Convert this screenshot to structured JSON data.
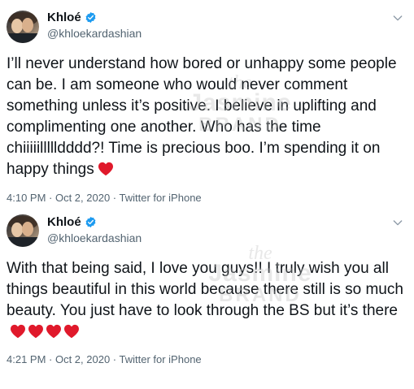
{
  "tweets": [
    {
      "name": "Khloé",
      "handle": "@khloekardashian",
      "text": "I’ll never understand how bored or unhappy some people can be. I am someone who would never comment something unless it’s positive. I believe in uplifting and complimenting one another. Who has the time chiiiiillllldddd?! Time is precious boo. I’m spending it on happy things",
      "hearts": 1,
      "meta": "4:10 PM · Oct 2, 2020 · Twitter for iPhone"
    },
    {
      "name": "Khloé",
      "handle": "@khloekardashian",
      "text": "With that being said, I love you guys!! I truly wish you all things beautiful in this world because there still is so much beauty. You just have to look through the BS but it’s there",
      "hearts": 4,
      "meta": "4:21 PM · Oct 2, 2020 · Twitter for iPhone"
    }
  ],
  "watermark": {
    "line1": "the",
    "line2": "Jasmine",
    "line3": "BRAND"
  },
  "icons": {
    "verified": "verified-badge-icon",
    "more": "chevron-down-icon",
    "heart": "red-heart-icon"
  },
  "colors": {
    "verified_blue": "#1d9bf0",
    "heart_red": "#e0192b",
    "secondary_text": "#536471"
  }
}
